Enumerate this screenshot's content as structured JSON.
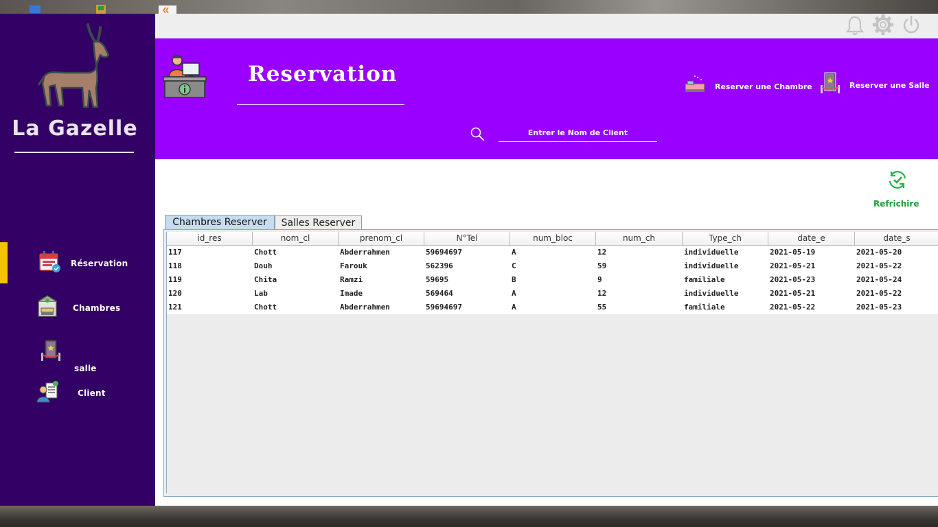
{
  "app": {
    "brand": "La Gazelle"
  },
  "sidebar": {
    "items": [
      {
        "label": "Réservation",
        "icon": "book-now-calendar-icon"
      },
      {
        "label": "Chambres",
        "icon": "hotel-room-icon"
      },
      {
        "label": "salle",
        "icon": "hall-door-icon"
      },
      {
        "label": "Client",
        "icon": "client-profile-icon"
      }
    ]
  },
  "topbar": {
    "icons": [
      "bell-icon",
      "gear-icon",
      "power-icon"
    ]
  },
  "header": {
    "title": "Reservation",
    "reserve_room_label": "Reserver une Chambre",
    "reserve_hall_label": "Reserver une Salle",
    "search_placeholder": "Entrer le Nom de Client"
  },
  "content": {
    "refresh_label": "Refrichire",
    "tabs": [
      {
        "label": "Chambres Reserver",
        "active": true
      },
      {
        "label": "Salles Reserver",
        "active": false
      }
    ],
    "table": {
      "columns": [
        "id_res",
        "nom_cl",
        "prenom_cl",
        "N°Tel",
        "num_bloc",
        "num_ch",
        "Type_ch",
        "date_e",
        "date_s"
      ],
      "rows": [
        [
          "117",
          "Chott",
          "Abderrahmen",
          "59694697",
          "A",
          "12",
          "individuelle",
          "2021-05-19",
          "2021-05-20"
        ],
        [
          "118",
          "Douh",
          "Farouk",
          "562396",
          "C",
          "59",
          "individuelle",
          "2021-05-21",
          "2021-05-22"
        ],
        [
          "119",
          "Chita",
          "Ramzi",
          "59695",
          "B",
          "9",
          "familiale",
          "2021-05-23",
          "2021-05-24"
        ],
        [
          "120",
          "Lab",
          "Imade",
          "569464",
          "A",
          "12",
          "individuelle",
          "2021-05-21",
          "2021-05-22"
        ],
        [
          "121",
          "Chott",
          "Abderrahmen",
          "59694697",
          "A",
          "55",
          "familiale",
          "2021-05-22",
          "2021-05-23"
        ]
      ]
    }
  },
  "colors": {
    "sidebar": "#330066",
    "header": "#9900ff",
    "nav_indicator": "#f5c400",
    "refresh": "#1a9e3a"
  }
}
